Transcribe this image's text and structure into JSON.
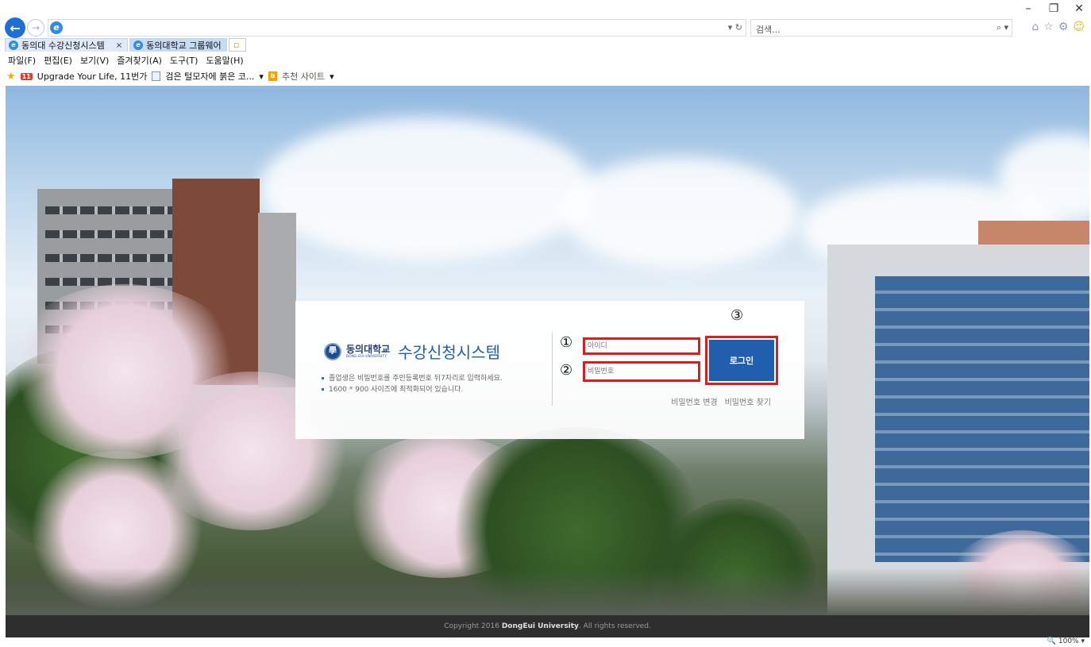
{
  "window": {
    "controls": [
      "–",
      "❐",
      "✕"
    ]
  },
  "toolbar": {
    "back_icon": "←",
    "forward_icon": "→",
    "address_tools": "▾ ↻",
    "search_placeholder": "검색...",
    "search_tools": "⌕ ▾",
    "right_icons": [
      "⌂",
      "☆",
      "⚙",
      "☺"
    ]
  },
  "tabs": [
    {
      "label": "동의대 수강신청시스템",
      "close": "×"
    },
    {
      "label": "동의대학교 그룹웨어"
    }
  ],
  "menu": [
    "파일(F)",
    "편집(E)",
    "보기(V)",
    "즐겨찾기(A)",
    "도구(T)",
    "도움말(H)"
  ],
  "favorites": {
    "item1_badge": "11",
    "item1": "Upgrade Your Life, 11번가",
    "item2": "검은 털모자에 붉은 코...",
    "item2_dropdown": "▾",
    "item3_badge": "b",
    "item3": "추천 사이트",
    "item3_dropdown": "▾"
  },
  "login": {
    "univ_ko": "동의대학교",
    "univ_en": "DONG-EUI UNIVERSITY",
    "system_name": "수강신청시스템",
    "notes": [
      "졸업생은 비밀번호를 주민등록번호 뒤7자리로 입력하세요.",
      "1600 * 900 사이즈에 최적화되어 있습니다."
    ],
    "id_placeholder": "아이디",
    "pw_placeholder": "비밀번호",
    "login_button": "로그인",
    "change_pw": "비밀번호 변경",
    "find_pw": "비밀번호 찾기",
    "markers": [
      "①",
      "②",
      "③"
    ]
  },
  "footer": {
    "prefix": "Copyright 2016 ",
    "bold": "DongEui University",
    "suffix": ". All rights reserved."
  },
  "status": {
    "zoom": "🔍 100%  ▾"
  }
}
